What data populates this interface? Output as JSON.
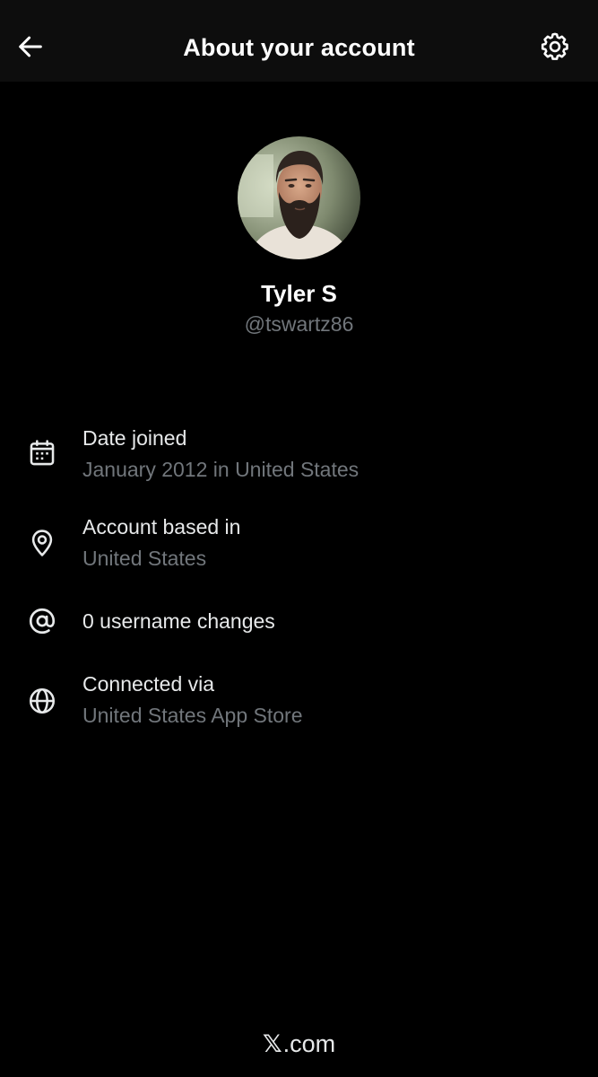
{
  "header": {
    "title": "About your account",
    "back_icon": "arrow-left-icon",
    "settings_icon": "gear-icon"
  },
  "profile": {
    "display_name": "Tyler S",
    "handle": "@tswartz86",
    "avatar": "avatar-photo"
  },
  "info": {
    "date_joined": {
      "icon": "calendar-icon",
      "title": "Date joined",
      "value": "January 2012 in United States"
    },
    "account_based": {
      "icon": "location-pin-icon",
      "title": "Account based in",
      "value": "United States"
    },
    "username_changes": {
      "icon": "at-sign-icon",
      "title": "0 username changes"
    },
    "connected_via": {
      "icon": "globe-icon",
      "title": "Connected via",
      "value": "United States App Store"
    }
  },
  "footer": {
    "x_mark": "𝕏",
    "domain": ".com"
  },
  "colors": {
    "background": "#000000",
    "header_bg": "#0d0d0d",
    "primary_text": "#e7e9ea",
    "secondary_text": "#71767b"
  }
}
